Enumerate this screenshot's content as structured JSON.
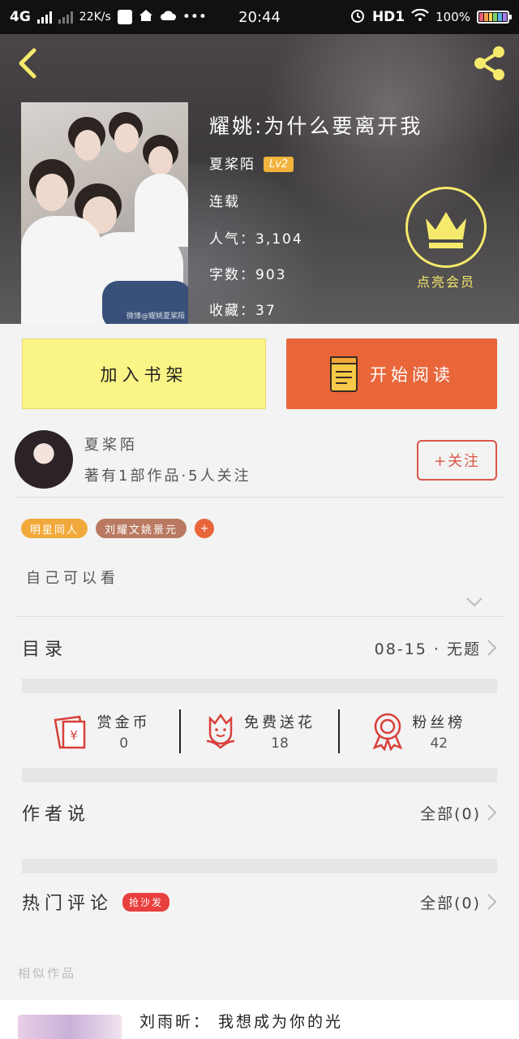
{
  "status_bar": {
    "network": "4G",
    "speed": "22K/s",
    "time": "20:44",
    "hd": "HD1",
    "battery": "100%",
    "more_dots": "•••"
  },
  "book": {
    "title": "耀姚:为什么要离开我",
    "author": "夏桨陌",
    "author_level": "Lv2",
    "status": "连载",
    "popularity_label": "人气：",
    "popularity": "3,104",
    "word_count_label": "字数：",
    "word_count": "903",
    "favorites_label": "收藏：",
    "favorites": "37",
    "cover_watermark": "微博@耀姚夏桨陌"
  },
  "vip": {
    "label": "点亮会员",
    "color": "#f5ea6c"
  },
  "actions": {
    "add_shelf": "加入书架",
    "start_reading": "开始阅读",
    "shelf_color": "#fbf486",
    "read_color": "#e8663a"
  },
  "author": {
    "name": "夏桨陌",
    "stats": "著有1部作品·5人关注",
    "follow": "+关注"
  },
  "tags": [
    {
      "label": "明星同人",
      "color": "#f2a93b"
    },
    {
      "label": "刘耀文姚景元",
      "color": "#b97a61"
    },
    {
      "label": "+",
      "color": "#e8663a"
    }
  ],
  "description": "自己可以看",
  "catalog": {
    "title": "目录",
    "latest": "08-15 · 无题"
  },
  "gifts": [
    {
      "icon": "red-envelope-icon",
      "label": "赏金币",
      "value": "0"
    },
    {
      "icon": "flower-icon",
      "label": "免费送花",
      "value": "18"
    },
    {
      "icon": "ribbon-badge-icon",
      "label": "粉丝榜",
      "value": "42"
    }
  ],
  "author_says": {
    "title": "作者说",
    "all": "全部(0)"
  },
  "hot_comments": {
    "title": "热门评论",
    "badge": "抢沙发",
    "all": "全部(0)"
  },
  "similar": {
    "label": "相似作品",
    "items": [
      {
        "title": "刘雨昕： 我想成为你的光"
      }
    ]
  },
  "accent": "#d9574a"
}
